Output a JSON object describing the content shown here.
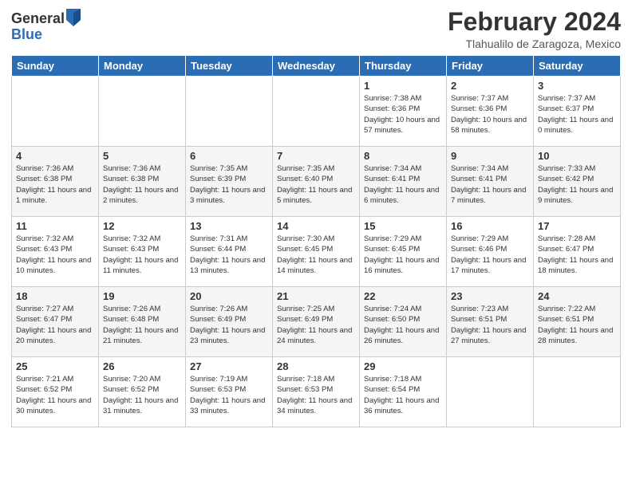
{
  "logo": {
    "general": "General",
    "blue": "Blue"
  },
  "title": "February 2024",
  "location": "Tlahualilo de Zaragoza, Mexico",
  "days_header": [
    "Sunday",
    "Monday",
    "Tuesday",
    "Wednesday",
    "Thursday",
    "Friday",
    "Saturday"
  ],
  "weeks": [
    [
      {
        "day": "",
        "info": ""
      },
      {
        "day": "",
        "info": ""
      },
      {
        "day": "",
        "info": ""
      },
      {
        "day": "",
        "info": ""
      },
      {
        "day": "1",
        "info": "Sunrise: 7:38 AM\nSunset: 6:36 PM\nDaylight: 10 hours and 57 minutes."
      },
      {
        "day": "2",
        "info": "Sunrise: 7:37 AM\nSunset: 6:36 PM\nDaylight: 10 hours and 58 minutes."
      },
      {
        "day": "3",
        "info": "Sunrise: 7:37 AM\nSunset: 6:37 PM\nDaylight: 11 hours and 0 minutes."
      }
    ],
    [
      {
        "day": "4",
        "info": "Sunrise: 7:36 AM\nSunset: 6:38 PM\nDaylight: 11 hours and 1 minute."
      },
      {
        "day": "5",
        "info": "Sunrise: 7:36 AM\nSunset: 6:38 PM\nDaylight: 11 hours and 2 minutes."
      },
      {
        "day": "6",
        "info": "Sunrise: 7:35 AM\nSunset: 6:39 PM\nDaylight: 11 hours and 3 minutes."
      },
      {
        "day": "7",
        "info": "Sunrise: 7:35 AM\nSunset: 6:40 PM\nDaylight: 11 hours and 5 minutes."
      },
      {
        "day": "8",
        "info": "Sunrise: 7:34 AM\nSunset: 6:41 PM\nDaylight: 11 hours and 6 minutes."
      },
      {
        "day": "9",
        "info": "Sunrise: 7:34 AM\nSunset: 6:41 PM\nDaylight: 11 hours and 7 minutes."
      },
      {
        "day": "10",
        "info": "Sunrise: 7:33 AM\nSunset: 6:42 PM\nDaylight: 11 hours and 9 minutes."
      }
    ],
    [
      {
        "day": "11",
        "info": "Sunrise: 7:32 AM\nSunset: 6:43 PM\nDaylight: 11 hours and 10 minutes."
      },
      {
        "day": "12",
        "info": "Sunrise: 7:32 AM\nSunset: 6:43 PM\nDaylight: 11 hours and 11 minutes."
      },
      {
        "day": "13",
        "info": "Sunrise: 7:31 AM\nSunset: 6:44 PM\nDaylight: 11 hours and 13 minutes."
      },
      {
        "day": "14",
        "info": "Sunrise: 7:30 AM\nSunset: 6:45 PM\nDaylight: 11 hours and 14 minutes."
      },
      {
        "day": "15",
        "info": "Sunrise: 7:29 AM\nSunset: 6:45 PM\nDaylight: 11 hours and 16 minutes."
      },
      {
        "day": "16",
        "info": "Sunrise: 7:29 AM\nSunset: 6:46 PM\nDaylight: 11 hours and 17 minutes."
      },
      {
        "day": "17",
        "info": "Sunrise: 7:28 AM\nSunset: 6:47 PM\nDaylight: 11 hours and 18 minutes."
      }
    ],
    [
      {
        "day": "18",
        "info": "Sunrise: 7:27 AM\nSunset: 6:47 PM\nDaylight: 11 hours and 20 minutes."
      },
      {
        "day": "19",
        "info": "Sunrise: 7:26 AM\nSunset: 6:48 PM\nDaylight: 11 hours and 21 minutes."
      },
      {
        "day": "20",
        "info": "Sunrise: 7:26 AM\nSunset: 6:49 PM\nDaylight: 11 hours and 23 minutes."
      },
      {
        "day": "21",
        "info": "Sunrise: 7:25 AM\nSunset: 6:49 PM\nDaylight: 11 hours and 24 minutes."
      },
      {
        "day": "22",
        "info": "Sunrise: 7:24 AM\nSunset: 6:50 PM\nDaylight: 11 hours and 26 minutes."
      },
      {
        "day": "23",
        "info": "Sunrise: 7:23 AM\nSunset: 6:51 PM\nDaylight: 11 hours and 27 minutes."
      },
      {
        "day": "24",
        "info": "Sunrise: 7:22 AM\nSunset: 6:51 PM\nDaylight: 11 hours and 28 minutes."
      }
    ],
    [
      {
        "day": "25",
        "info": "Sunrise: 7:21 AM\nSunset: 6:52 PM\nDaylight: 11 hours and 30 minutes."
      },
      {
        "day": "26",
        "info": "Sunrise: 7:20 AM\nSunset: 6:52 PM\nDaylight: 11 hours and 31 minutes."
      },
      {
        "day": "27",
        "info": "Sunrise: 7:19 AM\nSunset: 6:53 PM\nDaylight: 11 hours and 33 minutes."
      },
      {
        "day": "28",
        "info": "Sunrise: 7:18 AM\nSunset: 6:53 PM\nDaylight: 11 hours and 34 minutes."
      },
      {
        "day": "29",
        "info": "Sunrise: 7:18 AM\nSunset: 6:54 PM\nDaylight: 11 hours and 36 minutes."
      },
      {
        "day": "",
        "info": ""
      },
      {
        "day": "",
        "info": ""
      }
    ]
  ]
}
